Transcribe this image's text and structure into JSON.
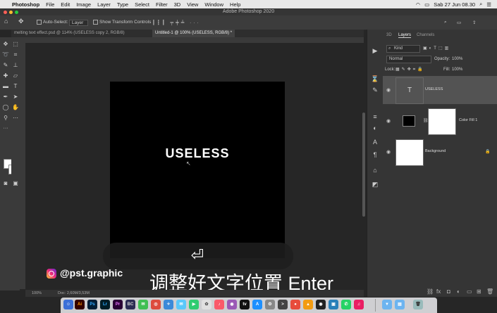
{
  "menubar": {
    "app": "Photoshop",
    "items": [
      "File",
      "Edit",
      "Image",
      "Layer",
      "Type",
      "Select",
      "Filter",
      "3D",
      "View",
      "Window",
      "Help"
    ],
    "datetime": "Sab 27 Jun 08.30"
  },
  "window": {
    "title": "Adobe Photoshop 2020"
  },
  "options": {
    "auto_select": "Auto-Select:",
    "auto_select_value": "Layer",
    "show_transform": "Show Transform Controls"
  },
  "tabs": [
    {
      "label": "melting text effect.psd @ 114% (USELESS copy 2, RGB/8)"
    },
    {
      "label": "Untitled-1 @ 100% (USELESS, RGB/8) *"
    }
  ],
  "canvas": {
    "text": "USELESS"
  },
  "status": {
    "zoom": "100%",
    "doc": "Doc: 2,60M/3,53M"
  },
  "overlay": {
    "handle": "@pst.graphic",
    "caption": "调整好文字位置 Enter",
    "key_glyph": "⏎"
  },
  "panel": {
    "tab_3d": "3D",
    "tab_layers": "Layers",
    "tab_channels": "Channels",
    "kind": "Kind",
    "blend_mode": "Normal",
    "opacity_label": "Opacity:",
    "opacity_value": "100%",
    "lock_label": "Lock:",
    "fill_label": "Fill:",
    "fill_value": "100%",
    "layers": [
      {
        "name": "USELESS",
        "thumb": "T"
      },
      {
        "name": "Color Fill 1"
      },
      {
        "name": "Background"
      }
    ]
  },
  "dock": {
    "apps": [
      {
        "label": "Ai",
        "color": "#330000"
      },
      {
        "label": "Ps",
        "color": "#001e36"
      },
      {
        "label": "Lr",
        "color": "#001d26"
      },
      {
        "label": "Pr",
        "color": "#2a0035"
      },
      {
        "label": "BC",
        "color": "#2c2c54"
      }
    ]
  }
}
